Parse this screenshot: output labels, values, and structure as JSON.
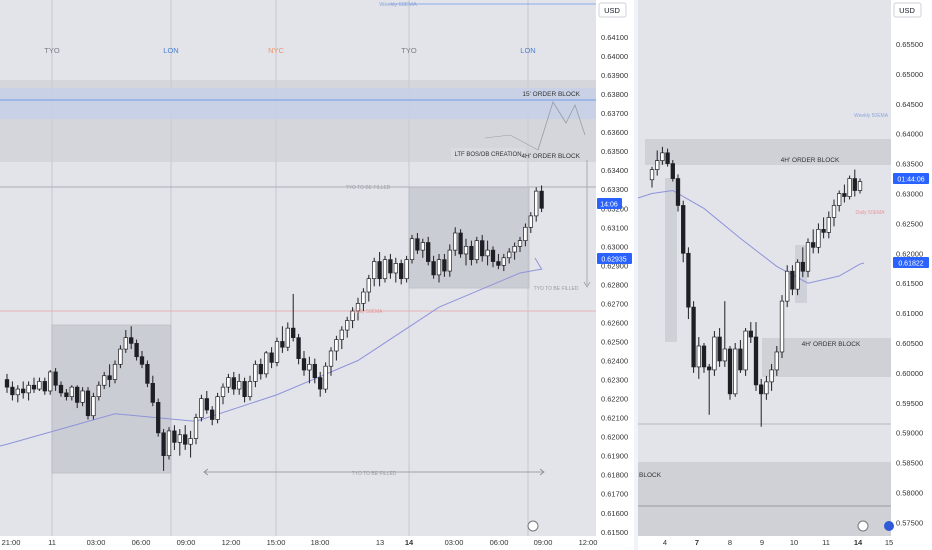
{
  "colors": {
    "background": "#e2e4ea",
    "candle_up": "#ffffff",
    "candle_down": "#1e1f24",
    "ma_line": "#8f93d8",
    "session_line": "#c7c9d3",
    "tyo": "#7b7d86",
    "lon": "#4a7fd0",
    "nyc": "#e8956a",
    "price_tag": "#2962ff",
    "ob_box": "#c9cad0",
    "blue_band": "#c6d0e6",
    "blue_line": "#6f9be8",
    "red_line": "#e8a2a2"
  },
  "chart_data": [
    {
      "type": "candlestick",
      "name": "left-panel",
      "currency": "USD",
      "ylim": [
        0.615,
        0.642
      ],
      "y_ticks": [
        "0.64100",
        "0.64000",
        "0.63900",
        "0.63800",
        "0.63700",
        "0.63600",
        "0.63500",
        "0.63400",
        "0.63300",
        "0.63200",
        "0.63100",
        "0.63000",
        "0.62900",
        "0.62800",
        "0.62700",
        "0.62600",
        "0.62500",
        "0.62400",
        "0.62300",
        "0.62200",
        "0.62100",
        "0.62000",
        "0.61900",
        "0.61800",
        "0.61700",
        "0.61600",
        "0.61500"
      ],
      "x_ticks": [
        "21:00",
        "11",
        "03:00",
        "06:00",
        "09:00",
        "12:00",
        "15:00",
        "18:00",
        "13",
        "14",
        "03:00",
        "06:00",
        "09:00",
        "12:00"
      ],
      "sessions": [
        "TYO",
        "LON",
        "NYC",
        "TYO",
        "LON"
      ],
      "price_tags": {
        "time_remaining": "14:06",
        "last_price": "0.62935"
      },
      "annotations": {
        "weekly_label": "Weekly 50EMA",
        "ob_15": "15' ORDER BLOCK",
        "ob_4h": "4H' ORDER BLOCK",
        "ltf": "LTF BOS/OB CREATION",
        "tyo_filled_top": "TYO TO BE  FILLED",
        "tyo_filled_right": "TYO TO BE  FILLED",
        "tyo_filled_bottom": "TYO TO BE  FILLED",
        "daily_label": "Daily 50EMA"
      },
      "candles": [
        {
          "o": 0.623,
          "h": 0.6233,
          "l": 0.6223,
          "c": 0.6226
        },
        {
          "o": 0.6226,
          "h": 0.6229,
          "l": 0.6219,
          "c": 0.6222
        },
        {
          "o": 0.6222,
          "h": 0.6227,
          "l": 0.6218,
          "c": 0.6225
        },
        {
          "o": 0.6225,
          "h": 0.6229,
          "l": 0.622,
          "c": 0.6223
        },
        {
          "o": 0.6223,
          "h": 0.6229,
          "l": 0.6219,
          "c": 0.6227
        },
        {
          "o": 0.6227,
          "h": 0.6231,
          "l": 0.6223,
          "c": 0.6225
        },
        {
          "o": 0.6225,
          "h": 0.6231,
          "l": 0.6224,
          "c": 0.6229
        },
        {
          "o": 0.6229,
          "h": 0.6231,
          "l": 0.6222,
          "c": 0.6224
        },
        {
          "o": 0.6224,
          "h": 0.6235,
          "l": 0.6222,
          "c": 0.6234
        },
        {
          "o": 0.6234,
          "h": 0.6236,
          "l": 0.6224,
          "c": 0.6227
        },
        {
          "o": 0.6227,
          "h": 0.6229,
          "l": 0.6221,
          "c": 0.6223
        },
        {
          "o": 0.6223,
          "h": 0.6225,
          "l": 0.6219,
          "c": 0.6221
        },
        {
          "o": 0.6221,
          "h": 0.6227,
          "l": 0.6219,
          "c": 0.6226
        },
        {
          "o": 0.6226,
          "h": 0.6227,
          "l": 0.6215,
          "c": 0.6218
        },
        {
          "o": 0.6218,
          "h": 0.6226,
          "l": 0.6216,
          "c": 0.6224
        },
        {
          "o": 0.6224,
          "h": 0.6226,
          "l": 0.6209,
          "c": 0.6211
        },
        {
          "o": 0.6211,
          "h": 0.6223,
          "l": 0.6209,
          "c": 0.6221
        },
        {
          "o": 0.6221,
          "h": 0.6229,
          "l": 0.6219,
          "c": 0.6227
        },
        {
          "o": 0.6227,
          "h": 0.6234,
          "l": 0.6225,
          "c": 0.6232
        },
        {
          "o": 0.6232,
          "h": 0.6238,
          "l": 0.6226,
          "c": 0.623
        },
        {
          "o": 0.623,
          "h": 0.624,
          "l": 0.6228,
          "c": 0.6238
        },
        {
          "o": 0.6238,
          "h": 0.6248,
          "l": 0.6236,
          "c": 0.6246
        },
        {
          "o": 0.6246,
          "h": 0.6256,
          "l": 0.6244,
          "c": 0.6252
        },
        {
          "o": 0.6252,
          "h": 0.6258,
          "l": 0.6246,
          "c": 0.6249
        },
        {
          "o": 0.6249,
          "h": 0.6251,
          "l": 0.624,
          "c": 0.6242
        },
        {
          "o": 0.6242,
          "h": 0.6245,
          "l": 0.6236,
          "c": 0.6238
        },
        {
          "o": 0.6238,
          "h": 0.624,
          "l": 0.6226,
          "c": 0.6228
        },
        {
          "o": 0.6228,
          "h": 0.6232,
          "l": 0.6216,
          "c": 0.6218
        },
        {
          "o": 0.6218,
          "h": 0.622,
          "l": 0.62,
          "c": 0.6202
        },
        {
          "o": 0.6202,
          "h": 0.6204,
          "l": 0.6182,
          "c": 0.619
        },
        {
          "o": 0.619,
          "h": 0.6205,
          "l": 0.6188,
          "c": 0.6203
        },
        {
          "o": 0.6203,
          "h": 0.6206,
          "l": 0.6193,
          "c": 0.6197
        },
        {
          "o": 0.6197,
          "h": 0.6204,
          "l": 0.619,
          "c": 0.6201
        },
        {
          "o": 0.6201,
          "h": 0.6206,
          "l": 0.6193,
          "c": 0.6196
        },
        {
          "o": 0.6196,
          "h": 0.6203,
          "l": 0.6189,
          "c": 0.6199
        },
        {
          "o": 0.6199,
          "h": 0.6212,
          "l": 0.6196,
          "c": 0.621
        },
        {
          "o": 0.621,
          "h": 0.6222,
          "l": 0.6208,
          "c": 0.622
        },
        {
          "o": 0.622,
          "h": 0.6224,
          "l": 0.6212,
          "c": 0.6214
        },
        {
          "o": 0.6214,
          "h": 0.6216,
          "l": 0.6206,
          "c": 0.6209
        },
        {
          "o": 0.6209,
          "h": 0.6223,
          "l": 0.6207,
          "c": 0.6221
        },
        {
          "o": 0.6221,
          "h": 0.6228,
          "l": 0.6217,
          "c": 0.6226
        },
        {
          "o": 0.6226,
          "h": 0.6233,
          "l": 0.6223,
          "c": 0.6231
        },
        {
          "o": 0.6231,
          "h": 0.6234,
          "l": 0.6222,
          "c": 0.6225
        },
        {
          "o": 0.6225,
          "h": 0.6233,
          "l": 0.6222,
          "c": 0.6229
        },
        {
          "o": 0.6229,
          "h": 0.6231,
          "l": 0.6218,
          "c": 0.6221
        },
        {
          "o": 0.6221,
          "h": 0.6232,
          "l": 0.6219,
          "c": 0.6229
        },
        {
          "o": 0.6229,
          "h": 0.624,
          "l": 0.6226,
          "c": 0.6238
        },
        {
          "o": 0.6238,
          "h": 0.6241,
          "l": 0.623,
          "c": 0.6233
        },
        {
          "o": 0.6233,
          "h": 0.6245,
          "l": 0.6231,
          "c": 0.6244
        },
        {
          "o": 0.6244,
          "h": 0.6247,
          "l": 0.6236,
          "c": 0.6239
        },
        {
          "o": 0.6239,
          "h": 0.6252,
          "l": 0.6237,
          "c": 0.625
        },
        {
          "o": 0.625,
          "h": 0.6258,
          "l": 0.6244,
          "c": 0.6247
        },
        {
          "o": 0.6247,
          "h": 0.626,
          "l": 0.6245,
          "c": 0.6257
        },
        {
          "o": 0.6257,
          "h": 0.6275,
          "l": 0.625,
          "c": 0.6252
        },
        {
          "o": 0.6252,
          "h": 0.6254,
          "l": 0.6238,
          "c": 0.6241
        },
        {
          "o": 0.6241,
          "h": 0.6245,
          "l": 0.6232,
          "c": 0.6235
        },
        {
          "o": 0.6235,
          "h": 0.6242,
          "l": 0.6228,
          "c": 0.6238
        },
        {
          "o": 0.6238,
          "h": 0.6241,
          "l": 0.6228,
          "c": 0.6231
        },
        {
          "o": 0.6231,
          "h": 0.6234,
          "l": 0.6221,
          "c": 0.6225
        },
        {
          "o": 0.6225,
          "h": 0.6239,
          "l": 0.6223,
          "c": 0.6237
        },
        {
          "o": 0.6237,
          "h": 0.6247,
          "l": 0.6232,
          "c": 0.6245
        },
        {
          "o": 0.6245,
          "h": 0.6253,
          "l": 0.624,
          "c": 0.6251
        },
        {
          "o": 0.6251,
          "h": 0.6258,
          "l": 0.6246,
          "c": 0.6256
        },
        {
          "o": 0.6256,
          "h": 0.6263,
          "l": 0.6252,
          "c": 0.6261
        },
        {
          "o": 0.6261,
          "h": 0.6268,
          "l": 0.6257,
          "c": 0.6266
        },
        {
          "o": 0.6266,
          "h": 0.6273,
          "l": 0.6261,
          "c": 0.627
        },
        {
          "o": 0.627,
          "h": 0.6278,
          "l": 0.6266,
          "c": 0.6276
        },
        {
          "o": 0.6276,
          "h": 0.6285,
          "l": 0.6271,
          "c": 0.6283
        },
        {
          "o": 0.6283,
          "h": 0.6294,
          "l": 0.6279,
          "c": 0.6292
        },
        {
          "o": 0.6292,
          "h": 0.6297,
          "l": 0.6279,
          "c": 0.6283
        },
        {
          "o": 0.6283,
          "h": 0.6295,
          "l": 0.6281,
          "c": 0.6293
        },
        {
          "o": 0.6293,
          "h": 0.6296,
          "l": 0.6283,
          "c": 0.6286
        },
        {
          "o": 0.6286,
          "h": 0.6294,
          "l": 0.6281,
          "c": 0.6291
        },
        {
          "o": 0.6291,
          "h": 0.6293,
          "l": 0.628,
          "c": 0.6283
        },
        {
          "o": 0.6283,
          "h": 0.6295,
          "l": 0.6281,
          "c": 0.6293
        },
        {
          "o": 0.6293,
          "h": 0.6306,
          "l": 0.6291,
          "c": 0.6304
        },
        {
          "o": 0.6304,
          "h": 0.6307,
          "l": 0.6296,
          "c": 0.6298
        },
        {
          "o": 0.6298,
          "h": 0.6304,
          "l": 0.6294,
          "c": 0.6302
        },
        {
          "o": 0.6302,
          "h": 0.6305,
          "l": 0.629,
          "c": 0.6292
        },
        {
          "o": 0.6292,
          "h": 0.6295,
          "l": 0.6283,
          "c": 0.6285
        },
        {
          "o": 0.6285,
          "h": 0.6296,
          "l": 0.6281,
          "c": 0.6293
        },
        {
          "o": 0.6293,
          "h": 0.6296,
          "l": 0.6284,
          "c": 0.6287
        },
        {
          "o": 0.6287,
          "h": 0.6301,
          "l": 0.6284,
          "c": 0.6298
        },
        {
          "o": 0.6298,
          "h": 0.631,
          "l": 0.6295,
          "c": 0.6307
        },
        {
          "o": 0.6307,
          "h": 0.6309,
          "l": 0.6294,
          "c": 0.6296
        },
        {
          "o": 0.6296,
          "h": 0.6304,
          "l": 0.629,
          "c": 0.63
        },
        {
          "o": 0.63,
          "h": 0.6303,
          "l": 0.629,
          "c": 0.6293
        },
        {
          "o": 0.6293,
          "h": 0.6305,
          "l": 0.6291,
          "c": 0.6303
        },
        {
          "o": 0.6303,
          "h": 0.6306,
          "l": 0.6292,
          "c": 0.6295
        },
        {
          "o": 0.6295,
          "h": 0.6303,
          "l": 0.629,
          "c": 0.6298
        },
        {
          "o": 0.6298,
          "h": 0.63,
          "l": 0.6289,
          "c": 0.6292
        },
        {
          "o": 0.6292,
          "h": 0.6296,
          "l": 0.6288,
          "c": 0.629
        },
        {
          "o": 0.629,
          "h": 0.6296,
          "l": 0.6287,
          "c": 0.6294
        },
        {
          "o": 0.6294,
          "h": 0.6299,
          "l": 0.6291,
          "c": 0.6297
        },
        {
          "o": 0.6297,
          "h": 0.6302,
          "l": 0.6293,
          "c": 0.63
        },
        {
          "o": 0.63,
          "h": 0.6305,
          "l": 0.6297,
          "c": 0.6303
        },
        {
          "o": 0.6303,
          "h": 0.6312,
          "l": 0.63,
          "c": 0.631
        },
        {
          "o": 0.631,
          "h": 0.6318,
          "l": 0.6307,
          "c": 0.6316
        },
        {
          "o": 0.6316,
          "h": 0.6331,
          "l": 0.6313,
          "c": 0.6329
        },
        {
          "o": 0.6329,
          "h": 0.6332,
          "l": 0.6318,
          "c": 0.632
        }
      ],
      "ma": [
        [
          0,
          0.6196
        ],
        [
          20,
          0.6212
        ],
        [
          35,
          0.6208
        ],
        [
          50,
          0.6222
        ],
        [
          65,
          0.624
        ],
        [
          80,
          0.6268
        ],
        [
          95,
          0.6286
        ],
        [
          99,
          0.6288
        ]
      ]
    },
    {
      "type": "candlestick",
      "name": "right-panel",
      "currency": "USD",
      "ylim": [
        0.5735,
        0.6615
      ],
      "y_ticks": [
        "0.65500",
        "0.65000",
        "0.64500",
        "0.64000",
        "0.63500",
        "0.63000",
        "0.62500",
        "0.62000",
        "0.61500",
        "0.61000",
        "0.60500",
        "0.60000",
        "0.59500",
        "0.59000",
        "0.58500",
        "0.58000",
        "0.57500"
      ],
      "x_ticks": [
        "7",
        "8",
        "9",
        "10",
        "11",
        "14",
        "15"
      ],
      "x_ticks_bold": [
        "7",
        "14"
      ],
      "x_tick_left": "4",
      "price_tags": {
        "time_remaining": "01:44:06",
        "last_price": "0.61822"
      },
      "annotations": {
        "weekly_label": "Weekly 50EMA",
        "daily_label": "Daily 50EMA",
        "ob_4h_top": "4H' ORDER BLOCK",
        "ob_4h_mid": "4H' ORDER BLOCK",
        "block": "BLOCK"
      },
      "candles": [
        {
          "o": 0.6323,
          "h": 0.6345,
          "l": 0.631,
          "c": 0.634
        },
        {
          "o": 0.634,
          "h": 0.6372,
          "l": 0.633,
          "c": 0.6355
        },
        {
          "o": 0.6355,
          "h": 0.6378,
          "l": 0.6348,
          "c": 0.6368
        },
        {
          "o": 0.6368,
          "h": 0.6375,
          "l": 0.6345,
          "c": 0.635
        },
        {
          "o": 0.635,
          "h": 0.6356,
          "l": 0.632,
          "c": 0.6325
        },
        {
          "o": 0.6325,
          "h": 0.6332,
          "l": 0.627,
          "c": 0.628
        },
        {
          "o": 0.628,
          "h": 0.6288,
          "l": 0.6185,
          "c": 0.62
        },
        {
          "o": 0.62,
          "h": 0.621,
          "l": 0.609,
          "c": 0.611
        },
        {
          "o": 0.611,
          "h": 0.612,
          "l": 0.6,
          "c": 0.601
        },
        {
          "o": 0.601,
          "h": 0.606,
          "l": 0.599,
          "c": 0.6045
        },
        {
          "o": 0.6045,
          "h": 0.605,
          "l": 0.6,
          "c": 0.601
        },
        {
          "o": 0.601,
          "h": 0.6015,
          "l": 0.593,
          "c": 0.6005
        },
        {
          "o": 0.6005,
          "h": 0.607,
          "l": 0.5995,
          "c": 0.606
        },
        {
          "o": 0.606,
          "h": 0.6075,
          "l": 0.601,
          "c": 0.602
        },
        {
          "o": 0.602,
          "h": 0.612,
          "l": 0.601,
          "c": 0.604
        },
        {
          "o": 0.604,
          "h": 0.6045,
          "l": 0.5955,
          "c": 0.5965
        },
        {
          "o": 0.5965,
          "h": 0.605,
          "l": 0.596,
          "c": 0.604
        },
        {
          "o": 0.604,
          "h": 0.6055,
          "l": 0.6,
          "c": 0.6005
        },
        {
          "o": 0.6005,
          "h": 0.6075,
          "l": 0.5995,
          "c": 0.607
        },
        {
          "o": 0.607,
          "h": 0.6085,
          "l": 0.605,
          "c": 0.606
        },
        {
          "o": 0.606,
          "h": 0.6085,
          "l": 0.597,
          "c": 0.598
        },
        {
          "o": 0.598,
          "h": 0.599,
          "l": 0.591,
          "c": 0.5965
        },
        {
          "o": 0.5965,
          "h": 0.5995,
          "l": 0.5955,
          "c": 0.5985
        },
        {
          "o": 0.5985,
          "h": 0.6015,
          "l": 0.597,
          "c": 0.6005
        },
        {
          "o": 0.6005,
          "h": 0.6045,
          "l": 0.5995,
          "c": 0.6035
        },
        {
          "o": 0.6035,
          "h": 0.613,
          "l": 0.6025,
          "c": 0.612
        },
        {
          "o": 0.612,
          "h": 0.618,
          "l": 0.611,
          "c": 0.617
        },
        {
          "o": 0.617,
          "h": 0.618,
          "l": 0.613,
          "c": 0.614
        },
        {
          "o": 0.614,
          "h": 0.619,
          "l": 0.613,
          "c": 0.6185
        },
        {
          "o": 0.6185,
          "h": 0.621,
          "l": 0.616,
          "c": 0.617
        },
        {
          "o": 0.617,
          "h": 0.6225,
          "l": 0.616,
          "c": 0.6218
        },
        {
          "o": 0.6218,
          "h": 0.624,
          "l": 0.62,
          "c": 0.621
        },
        {
          "o": 0.621,
          "h": 0.625,
          "l": 0.62,
          "c": 0.624
        },
        {
          "o": 0.624,
          "h": 0.626,
          "l": 0.6225,
          "c": 0.6235
        },
        {
          "o": 0.6235,
          "h": 0.627,
          "l": 0.6225,
          "c": 0.626
        },
        {
          "o": 0.626,
          "h": 0.629,
          "l": 0.6245,
          "c": 0.628
        },
        {
          "o": 0.628,
          "h": 0.6305,
          "l": 0.627,
          "c": 0.63
        },
        {
          "o": 0.63,
          "h": 0.6315,
          "l": 0.6285,
          "c": 0.6295
        },
        {
          "o": 0.6295,
          "h": 0.633,
          "l": 0.629,
          "c": 0.6325
        },
        {
          "o": 0.6325,
          "h": 0.634,
          "l": 0.6295,
          "c": 0.6305
        },
        {
          "o": 0.6305,
          "h": 0.6325,
          "l": 0.63,
          "c": 0.632
        }
      ],
      "ma": [
        [
          0,
          0.63
        ],
        [
          4,
          0.6305
        ],
        [
          10,
          0.6275
        ],
        [
          17,
          0.6225
        ],
        [
          24,
          0.6178
        ],
        [
          30,
          0.615
        ],
        [
          36,
          0.6162
        ],
        [
          40,
          0.6182
        ]
      ]
    }
  ]
}
